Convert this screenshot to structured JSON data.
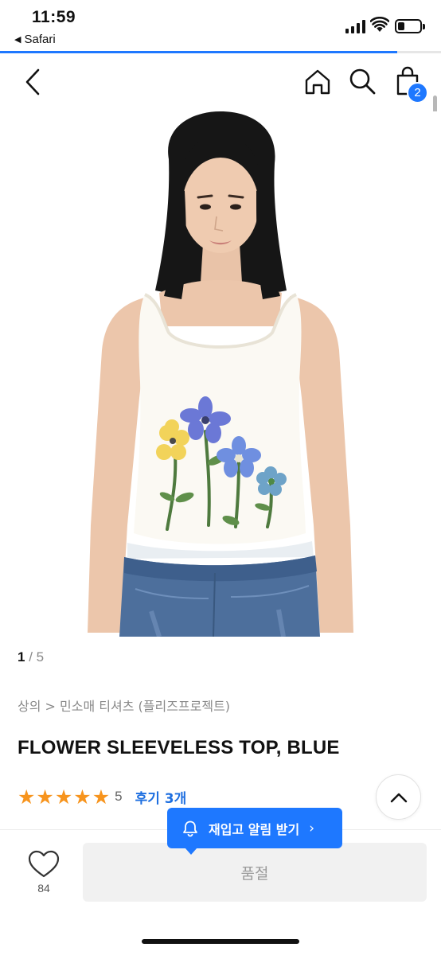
{
  "status_bar": {
    "time": "11:59",
    "back_app": "Safari",
    "page_load_progress": 0.9
  },
  "nav": {
    "cart_count": "2",
    "icons": [
      "back-icon",
      "home-icon",
      "search-icon",
      "cart-icon"
    ]
  },
  "gallery": {
    "current": "1",
    "separator": "/",
    "total": "5"
  },
  "product": {
    "breadcrumb": "상의 > 민소매 티셔츠 (플리즈프로젝트)",
    "title": "FLOWER SLEEVELESS TOP, BLUE",
    "rating": 5,
    "rating_label": "5",
    "review_label": "후기 3개"
  },
  "bottom_bar": {
    "wish_count": "84",
    "soldout_label": "품절",
    "restock_label": "재입고 알림 받기",
    "restock_chevron": "›"
  },
  "colors": {
    "accent": "#1e78ff",
    "star": "#f7941d",
    "review_link": "#1e6fe0",
    "soldout_bg": "#f1f1f1"
  }
}
